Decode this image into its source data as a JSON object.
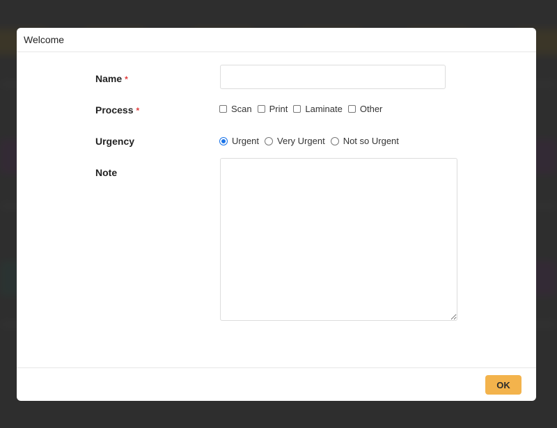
{
  "dialog": {
    "title": "Welcome",
    "fields": {
      "name": {
        "label": "Name",
        "required_mark": "*",
        "value": "",
        "placeholder": ""
      },
      "process": {
        "label": "Process",
        "required_mark": "*",
        "options": [
          {
            "label": "Scan",
            "checked": false
          },
          {
            "label": "Print",
            "checked": false
          },
          {
            "label": "Laminate",
            "checked": false
          },
          {
            "label": "Other",
            "checked": false
          }
        ]
      },
      "urgency": {
        "label": "Urgency",
        "options": [
          {
            "label": "Urgent",
            "selected": true
          },
          {
            "label": "Very Urgent",
            "selected": false
          },
          {
            "label": "Not so Urgent",
            "selected": false
          }
        ]
      },
      "note": {
        "label": "Note",
        "value": ""
      }
    },
    "footer": {
      "ok_label": "OK"
    }
  },
  "colors": {
    "accent_button": "#f3b34c",
    "required": "#e03b3b",
    "radio_selected": "#1a73e8"
  }
}
